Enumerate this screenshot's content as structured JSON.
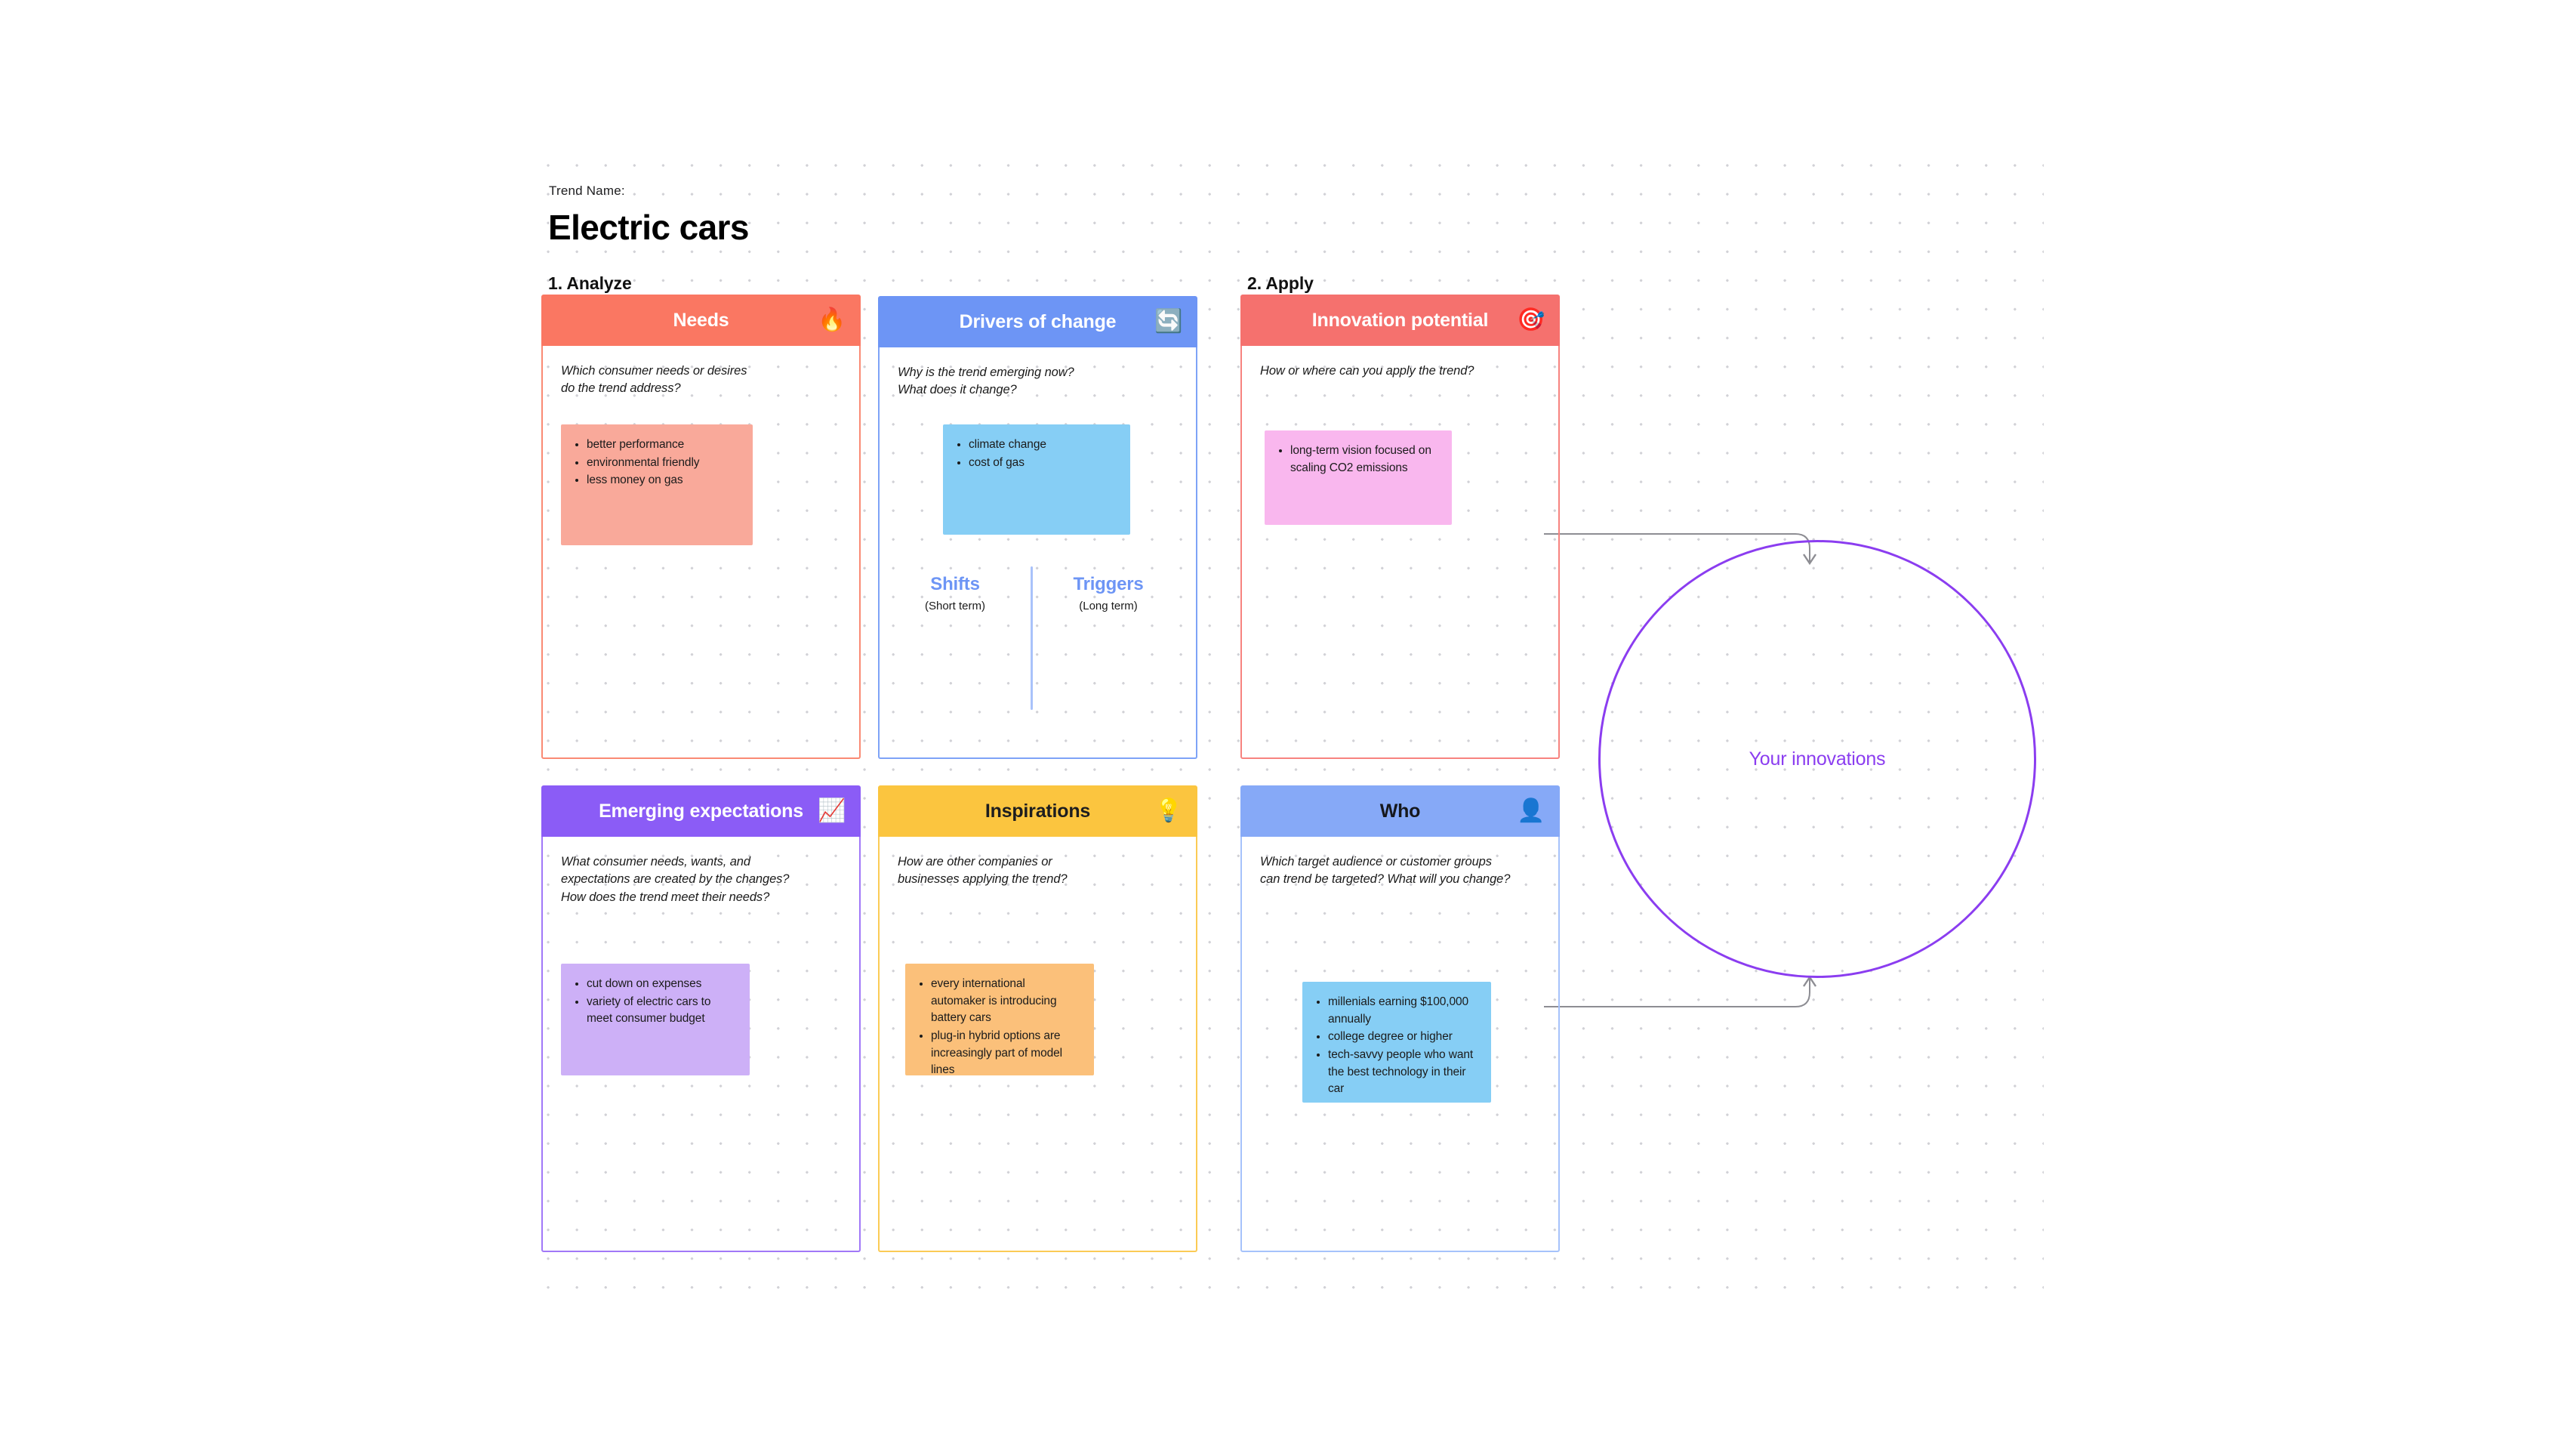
{
  "header": {
    "trend_label": "Trend Name:",
    "trend_title": "Electric cars"
  },
  "phases": {
    "analyze": "1. Analyze",
    "apply": "2. Apply"
  },
  "cards": [
    {
      "key": "needs",
      "title": "Needs",
      "icon": "flame-icon",
      "icon_glyph": "🔥",
      "prompt": "Which consumer needs or desires\ndo the trend address?",
      "note_items": [
        "better performance",
        "environmental friendly",
        "less money on gas"
      ],
      "header_color": "#fa7762",
      "note_color": "#f9a99a"
    },
    {
      "key": "drivers",
      "title": "Drivers of change",
      "icon": "recycle-arrows-icon",
      "icon_glyph": "🔄",
      "prompt": "Why is the trend emerging now?\nWhat does it change?",
      "note_items": [
        "climate change",
        "cost of gas"
      ],
      "header_color": "#6d95f5",
      "note_color": "#86cef5"
    },
    {
      "key": "innovation",
      "title": "Innovation potential",
      "icon": "dart-target-icon",
      "icon_glyph": "🎯",
      "prompt": "How or where can you apply the trend?",
      "note_items": [
        "long-term vision focused on scaling CO2 emissions"
      ],
      "header_color": "#f5716e",
      "note_color": "#f9b7ee"
    },
    {
      "key": "emerging",
      "title": "Emerging expectations",
      "icon": "chart-increasing-icon",
      "icon_glyph": "📈",
      "prompt": "What consumer needs, wants, and\nexpectations are created by the changes?\nHow does the trend meet their needs?",
      "note_items": [
        "cut down on expenses",
        "variety of electric cars to meet consumer budget"
      ],
      "header_color": "#8b5cf6",
      "note_color": "#cdb0f7"
    },
    {
      "key": "inspirations",
      "title": "Inspirations",
      "icon": "light-bulb-icon",
      "icon_glyph": "💡",
      "prompt": "How are other companies or\nbusinesses applying the trend?",
      "note_items": [
        "every international automaker is introducing battery cars",
        "plug-in hybrid options are increasingly part of model lines"
      ],
      "header_color": "#fbc53f",
      "note_color": "#fbc07a"
    },
    {
      "key": "who",
      "title": "Who",
      "icon": "person-bust-icon",
      "icon_glyph": "👤",
      "prompt": "Which target audience or customer groups\ncan trend be targeted? What will you change?",
      "note_items": [
        "millenials earning $100,000 annually",
        "college degree or higher",
        "tech-savvy people who want the best technology in their car"
      ],
      "header_color": "#86a9f7",
      "note_color": "#86cef5"
    }
  ],
  "split": {
    "shifts_title": "Shifts",
    "shifts_sub": "(Short term)",
    "triggers_title": "Triggers",
    "triggers_sub": "(Long term)"
  },
  "innovation_circle": {
    "label": "Your innovations",
    "color": "#8b3df0"
  }
}
